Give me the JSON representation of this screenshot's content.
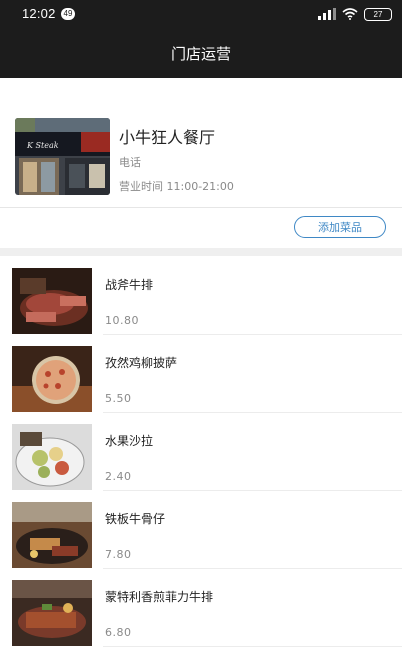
{
  "status_bar": {
    "time": "12:02",
    "notification_count": "49",
    "battery": "27"
  },
  "header": {
    "title": "门店运营"
  },
  "store": {
    "name": "小牛狂人餐厅",
    "phone_label": "电话",
    "hours": "营业时间 11:00-21:00",
    "sign_text": "K Steak"
  },
  "actions": {
    "add_dish_label": "添加菜品"
  },
  "dishes": [
    {
      "name": "战斧牛排",
      "price": "10.80"
    },
    {
      "name": "孜然鸡柳披萨",
      "price": "5.50"
    },
    {
      "name": "水果沙拉",
      "price": "2.40"
    },
    {
      "name": "铁板牛骨仔",
      "price": "7.80"
    },
    {
      "name": "蒙特利香煎菲力牛排",
      "price": "6.80"
    }
  ],
  "colors": {
    "header_bg": "#1c1c1c",
    "accent": "#3f88c5",
    "muted_text": "#8a8a8a"
  },
  "icons": [
    "signal-icon",
    "wifi-icon",
    "battery-icon"
  ]
}
